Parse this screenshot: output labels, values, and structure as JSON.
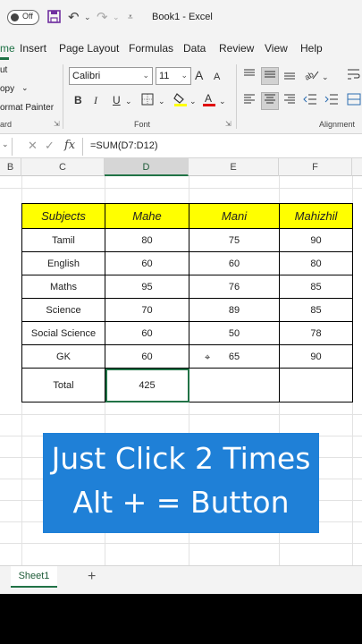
{
  "titlebar": {
    "autosave_label": "Off",
    "title": "Book1  -  Excel",
    "icons": [
      "save-icon",
      "undo-icon",
      "redo-icon",
      "customize-icon"
    ]
  },
  "ribbon_tabs": [
    "me",
    "Insert",
    "Page Layout",
    "Formulas",
    "Data",
    "Review",
    "View",
    "Help"
  ],
  "clipboard": {
    "cut_label": "ut",
    "copy_label": "opy",
    "format_painter_label": "ormat Painter",
    "group_label": "ard"
  },
  "font": {
    "name": "Calibri",
    "size": "11",
    "group_label": "Font",
    "grow_label": "A",
    "shrink_label": "A",
    "bold_label": "B",
    "italic_label": "I",
    "underline_label": "U"
  },
  "alignment": {
    "group_label": "Alignment"
  },
  "formula_bar": {
    "fx_label": "fx",
    "formula": "=SUM(D7:D12)"
  },
  "columns": [
    "B",
    "C",
    "D",
    "E",
    "F"
  ],
  "selected_column": "D",
  "table": {
    "headers": [
      "Subjects",
      "Mahe",
      "Mani",
      "Mahizhil"
    ],
    "rows": [
      [
        "Tamil",
        "80",
        "75",
        "90"
      ],
      [
        "English",
        "60",
        "60",
        "80"
      ],
      [
        "Maths",
        "95",
        "76",
        "85"
      ],
      [
        "Science",
        "70",
        "89",
        "85"
      ],
      [
        "Social Science",
        "60",
        "50",
        "78"
      ],
      [
        "GK",
        "60",
        "65",
        "90"
      ]
    ],
    "total_label": "Total",
    "total_value": "425"
  },
  "caption": {
    "line1": "Just Click 2 Times",
    "line2": "Alt + = Button",
    "color": "#1f80d7"
  },
  "sheet": {
    "tab_label": "Sheet1",
    "add_label": "+"
  },
  "colors": {
    "accent": "#217346",
    "header_fill": "#ffff00"
  }
}
